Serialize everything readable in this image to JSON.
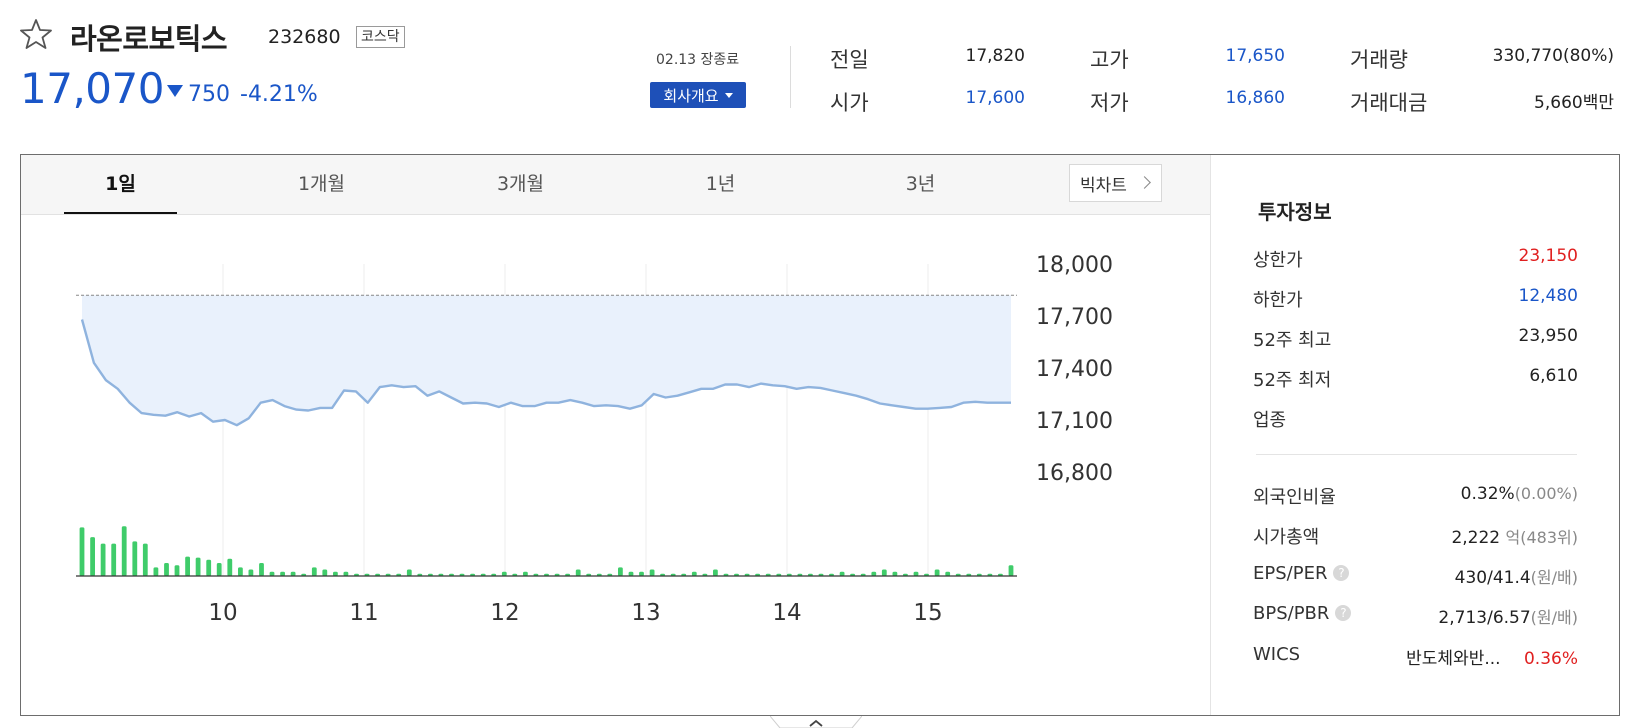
{
  "header": {
    "name": "라온로보틱스",
    "code": "232680",
    "market": "코스닥",
    "price": "17,070",
    "change_amount": "750",
    "change_percent": "-4.21%",
    "direction": "down",
    "status": "02.13 장종료",
    "company_button": "회사개요"
  },
  "quote": {
    "prev_close_label": "전일",
    "prev_close": "17,820",
    "open_label": "시가",
    "open": "17,600",
    "high_label": "고가",
    "high": "17,650",
    "low_label": "저가",
    "low": "16,860",
    "volume_label": "거래량",
    "volume": "330,770(80%)",
    "trade_value_label": "거래대금",
    "trade_value": "5,660백만"
  },
  "tabs": [
    "1일",
    "1개월",
    "3개월",
    "1년",
    "3년"
  ],
  "active_tab": "1일",
  "big_chart_label": "빅차트",
  "chart_data": {
    "type": "line",
    "x_labels": [
      "10",
      "11",
      "12",
      "13",
      "14",
      "15"
    ],
    "y_ticks": [
      18000,
      17700,
      17400,
      17100,
      16800
    ],
    "ylim": [
      16800,
      18000
    ],
    "reference_line": 17820,
    "series": [
      {
        "values": [
          17680,
          17430,
          17330,
          17280,
          17200,
          17140,
          17130,
          17125,
          17145,
          17120,
          17140,
          17090,
          17100,
          17070,
          17110,
          17200,
          17215,
          17180,
          17160,
          17155,
          17170,
          17170,
          17270,
          17265,
          17200,
          17290,
          17300,
          17290,
          17295,
          17240,
          17265,
          17230,
          17195,
          17200,
          17195,
          17175,
          17200,
          17180,
          17180,
          17200,
          17200,
          17215,
          17200,
          17180,
          17185,
          17180,
          17165,
          17185,
          17250,
          17230,
          17240,
          17260,
          17280,
          17280,
          17305,
          17305,
          17290,
          17310,
          17300,
          17295,
          17280,
          17290,
          17285,
          17270,
          17255,
          17240,
          17220,
          17195,
          17185,
          17175,
          17165,
          17165,
          17170,
          17175,
          17200,
          17205,
          17200,
          17200,
          17200
        ]
      },
      {
        "name": "volume",
        "values": [
          45,
          36,
          30,
          30,
          46,
          32,
          30,
          8,
          12,
          10,
          18,
          17,
          15,
          12,
          16,
          8,
          6,
          12,
          4,
          4,
          4,
          2,
          8,
          6,
          4,
          4,
          2,
          2,
          2,
          2,
          2,
          6,
          2,
          2,
          2,
          2,
          2,
          2,
          2,
          2,
          4,
          2,
          4,
          2,
          2,
          2,
          2,
          6,
          2,
          2,
          2,
          8,
          4,
          4,
          6,
          2,
          2,
          2,
          4,
          2,
          6,
          2,
          2,
          2,
          2,
          2,
          2,
          2,
          2,
          2,
          2,
          2,
          4,
          2,
          2,
          4,
          6,
          4,
          2,
          4,
          2,
          6,
          4,
          2,
          2,
          2,
          2,
          2,
          10
        ]
      }
    ]
  },
  "invest": {
    "title": "투자정보",
    "upper_limit_label": "상한가",
    "upper_limit": "23,150",
    "lower_limit_label": "하한가",
    "lower_limit": "12,480",
    "w52_high_label": "52주 최고",
    "w52_high": "23,950",
    "w52_low_label": "52주 최저",
    "w52_low": "6,610",
    "sector_label": "업종",
    "foreign_label": "외국인비율",
    "foreign_value": "0.32%",
    "foreign_change": "(0.00%)",
    "market_cap_label": "시가총액",
    "market_cap_value": "2,222",
    "market_cap_unit": "억",
    "market_cap_rank": "(483위)",
    "eps_per_label": "EPS/PER",
    "eps_per_value": "430/41.4",
    "eps_per_unit": "(원/배)",
    "bps_pbr_label": "BPS/PBR",
    "bps_pbr_value": "2,713/6.57",
    "bps_pbr_unit": "(원/배)",
    "wics_label": "WICS",
    "wics_value": "반도체와반...",
    "wics_change": "0.36%"
  },
  "colors": {
    "accent_blue": "#1a56c8",
    "up_red": "#e02020",
    "line": "#8fb3de",
    "fill": "#e9f1fc",
    "volume": "#3fcc6a"
  }
}
